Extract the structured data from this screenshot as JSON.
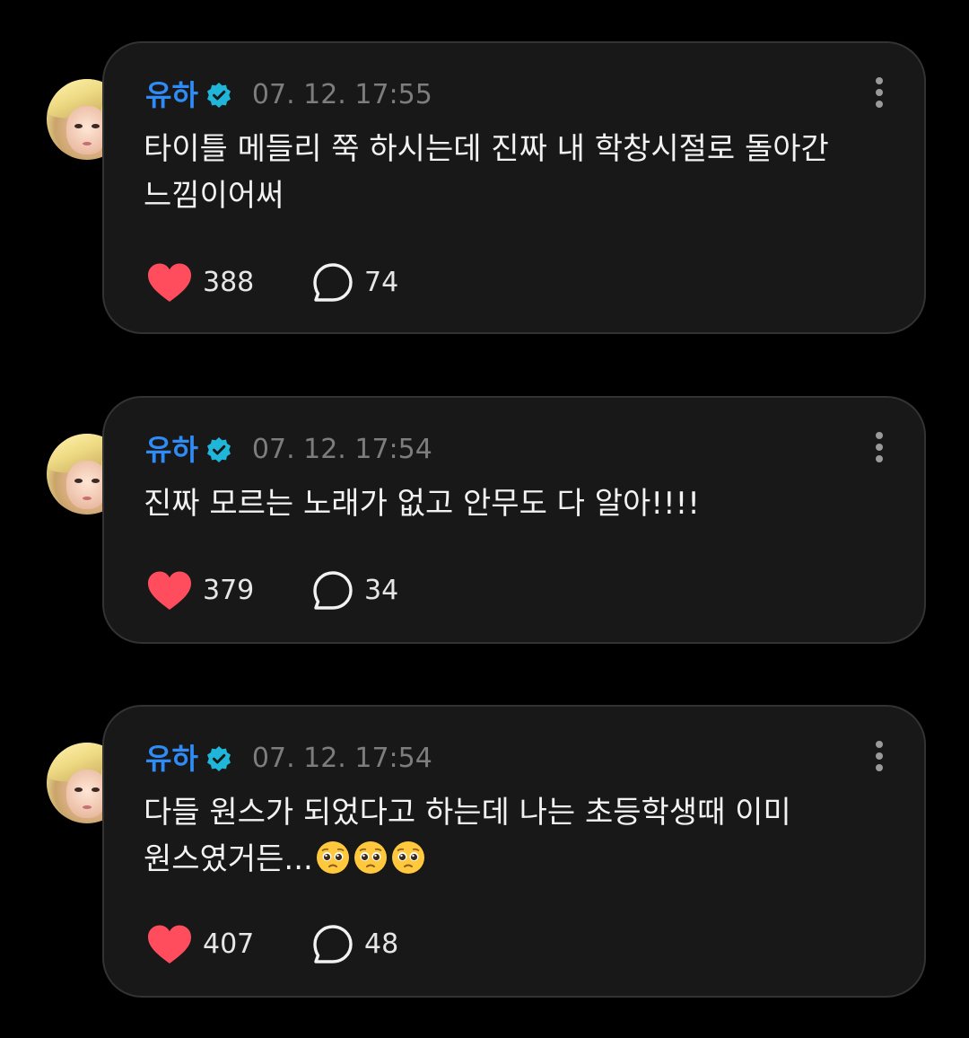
{
  "posts": [
    {
      "username": "유하",
      "timestamp": "07. 12. 17:55",
      "text": "타이틀 메들리 쭉 하시는데 진짜 내 학창시절로 돌아간\n느낌이어써",
      "emoji": "",
      "likes": "388",
      "comments": "74"
    },
    {
      "username": "유하",
      "timestamp": "07. 12. 17:54",
      "text": "진짜 모르는 노래가 없고 안무도 다 알아!!!!",
      "emoji": "",
      "likes": "379",
      "comments": "34"
    },
    {
      "username": "유하",
      "timestamp": "07. 12. 17:54",
      "text": "다들 원스가 되었다고 하는데 나는 초등학생때 이미\n원스였거든...",
      "emoji": "🥺🥺🥺",
      "likes": "407",
      "comments": "48"
    }
  ],
  "colors": {
    "background": "#000000",
    "card": "#181818",
    "username": "#2f8cf6",
    "verified_badge": "#1fb6d9",
    "heart": "#ff4d5e",
    "timestamp": "#7d7d7d"
  },
  "icons": {
    "verified": "verified-badge-icon",
    "more": "more-vertical-icon",
    "like": "heart-icon",
    "comment": "comment-bubble-icon"
  }
}
